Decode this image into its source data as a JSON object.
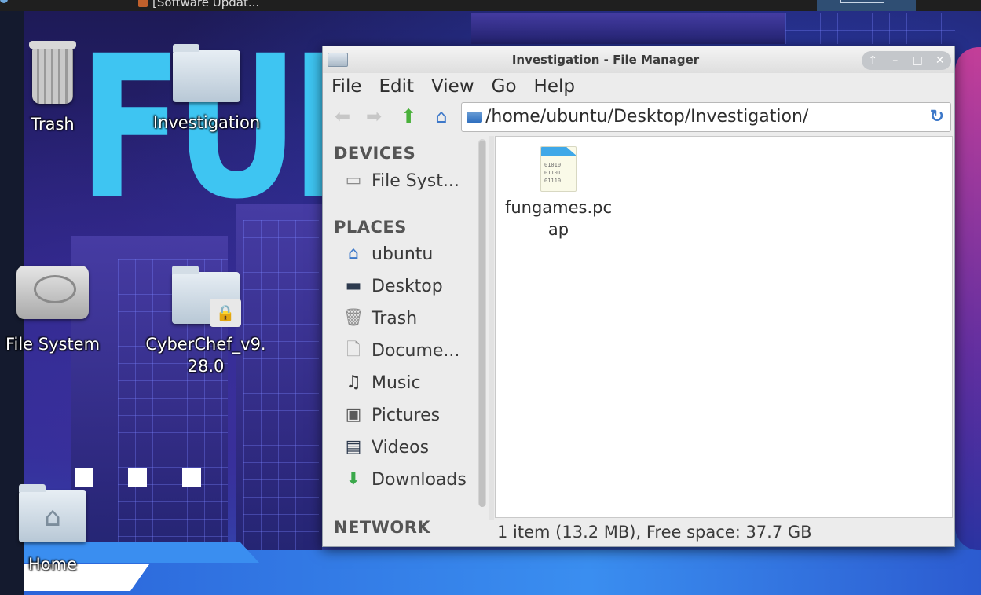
{
  "taskbar": {
    "task_label": "[Software Updat..."
  },
  "wallpaper": {
    "headline": "FUN"
  },
  "desktop_icons": {
    "trash": "Trash",
    "investigation": "Investigation",
    "file_system": "File System",
    "cyberchef": "CyberChef_v9.\n28.0",
    "home": "Home"
  },
  "window": {
    "title": "Investigation - File Manager",
    "buttons": {
      "shade": "↑",
      "minimize": "–",
      "maximize": "□",
      "close": "✕"
    },
    "menu": [
      "File",
      "Edit",
      "View",
      "Go",
      "Help"
    ],
    "location": "/home/ubuntu/Desktop/Investigation/",
    "sidebar": {
      "devices_header": "DEVICES",
      "devices": [
        {
          "label": "File Syst...",
          "icon": "hard-drive-icon"
        }
      ],
      "places_header": "PLACES",
      "places": [
        {
          "label": "ubuntu",
          "icon": "home-icon"
        },
        {
          "label": "Desktop",
          "icon": "desktop-icon"
        },
        {
          "label": "Trash",
          "icon": "trash-icon"
        },
        {
          "label": "Docume...",
          "icon": "document-icon"
        },
        {
          "label": "Music",
          "icon": "music-icon"
        },
        {
          "label": "Pictures",
          "icon": "pictures-icon"
        },
        {
          "label": "Videos",
          "icon": "videos-icon"
        },
        {
          "label": "Downloads",
          "icon": "downloads-icon"
        }
      ],
      "network_header": "NETWORK"
    },
    "files": [
      {
        "name": "fungames.pcap",
        "icon": "binary-file-icon"
      }
    ],
    "status": "1 item (13.2 MB), Free space: 37.7 GB"
  },
  "colors": {
    "accent": "#3d78c9",
    "up_arrow": "#49b03a",
    "wallpaper_text": "#3ec5f2"
  }
}
